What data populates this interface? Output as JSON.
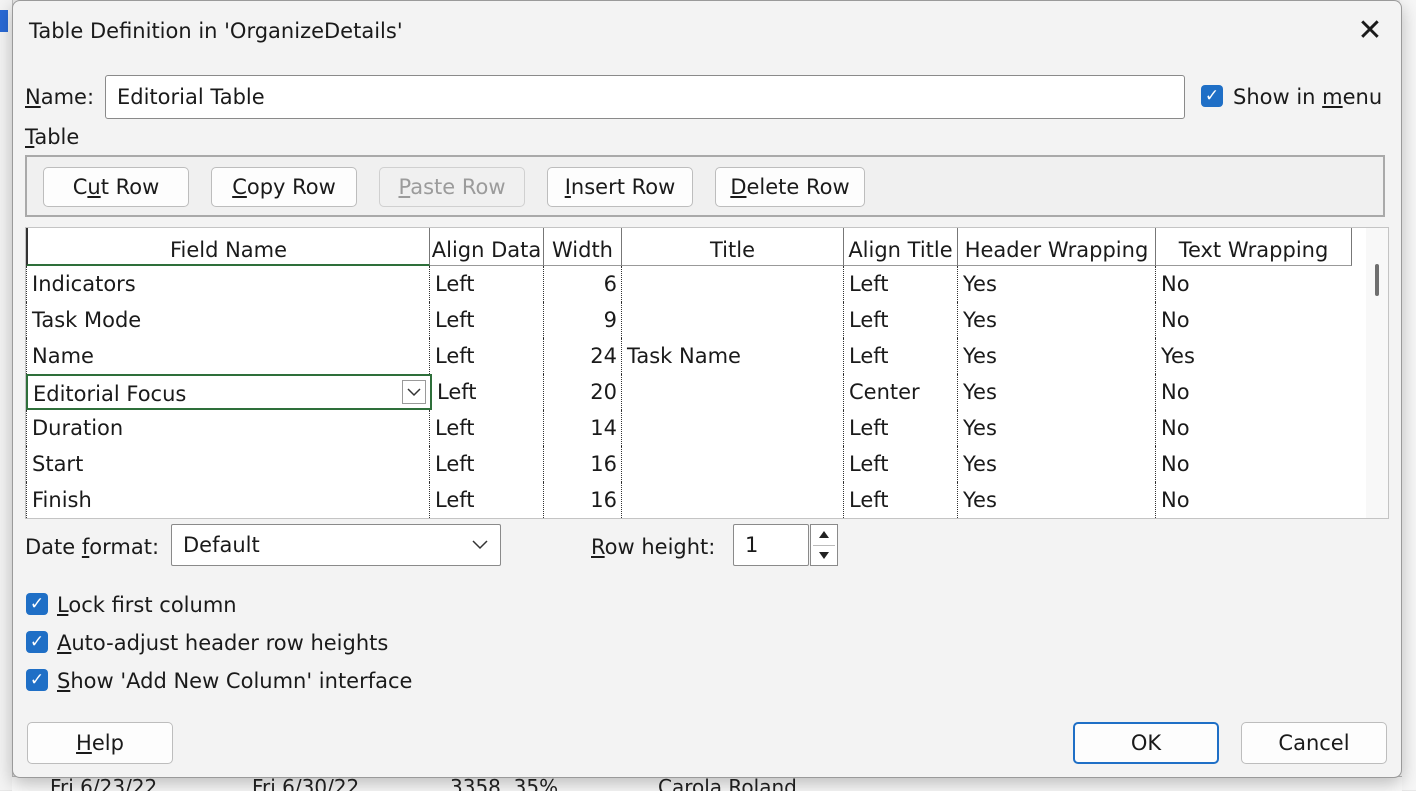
{
  "dialog": {
    "title": "Table Definition in 'OrganizeDetails'",
    "close_glyph": "✕"
  },
  "name": {
    "label_u": "N",
    "label_rest": "ame:",
    "value": "Editorial Table",
    "show_in_menu_pre": "Show in ",
    "show_in_menu_u": "m",
    "show_in_menu_post": "enu",
    "show_in_menu_checked": true
  },
  "table_label": {
    "u": "T",
    "rest": "able"
  },
  "toolbar": {
    "cut": {
      "pre": "C",
      "u": "u",
      "post": "t Row"
    },
    "copy": {
      "pre": "",
      "u": "C",
      "post": "opy Row"
    },
    "paste": {
      "pre": "",
      "u": "P",
      "post": "aste Row"
    },
    "insert": {
      "pre": "",
      "u": "I",
      "post": "nsert Row"
    },
    "delete": {
      "pre": "",
      "u": "D",
      "post": "elete Row"
    }
  },
  "grid": {
    "headers": [
      "Field Name",
      "Align Data",
      "Width",
      "Title",
      "Align Title",
      "Header Wrapping",
      "Text Wrapping"
    ],
    "rows": [
      [
        "Indicators",
        "Left",
        "6",
        "",
        "Left",
        "Yes",
        "No"
      ],
      [
        "Task Mode",
        "Left",
        "9",
        "",
        "Left",
        "Yes",
        "No"
      ],
      [
        "Name",
        "Left",
        "24",
        "Task Name",
        "Left",
        "Yes",
        "Yes"
      ],
      [
        "Editorial Focus",
        "Left",
        "20",
        "",
        "Center",
        "Yes",
        "No"
      ],
      [
        "Duration",
        "Left",
        "14",
        "",
        "Left",
        "Yes",
        "No"
      ],
      [
        "Start",
        "Left",
        "16",
        "",
        "Left",
        "Yes",
        "No"
      ],
      [
        "Finish",
        "Left",
        "16",
        "",
        "Left",
        "Yes",
        "No"
      ]
    ],
    "editing_row": 3
  },
  "date_format": {
    "pre": "Date ",
    "u": "f",
    "post": "ormat:",
    "value": "Default"
  },
  "row_height": {
    "u": "R",
    "post": "ow height:",
    "value": "1"
  },
  "options": [
    {
      "u": "L",
      "rest": "ock first column",
      "checked": true
    },
    {
      "u": "A",
      "rest": "uto-adjust header row heights",
      "checked": true
    },
    {
      "u": "S",
      "rest": "how 'Add New Column' interface",
      "checked": true
    }
  ],
  "footer": {
    "help_u": "H",
    "help_rest": "elp",
    "ok": "OK",
    "cancel": "Cancel"
  },
  "background": {
    "bottom_cells": [
      "Fri 6/23/22",
      "Fri 6/30/22",
      "3358, 35%",
      "Carola Roland"
    ]
  },
  "colors": {
    "accent": "#1f6fc6",
    "edit_border": "#2e6f3a"
  }
}
